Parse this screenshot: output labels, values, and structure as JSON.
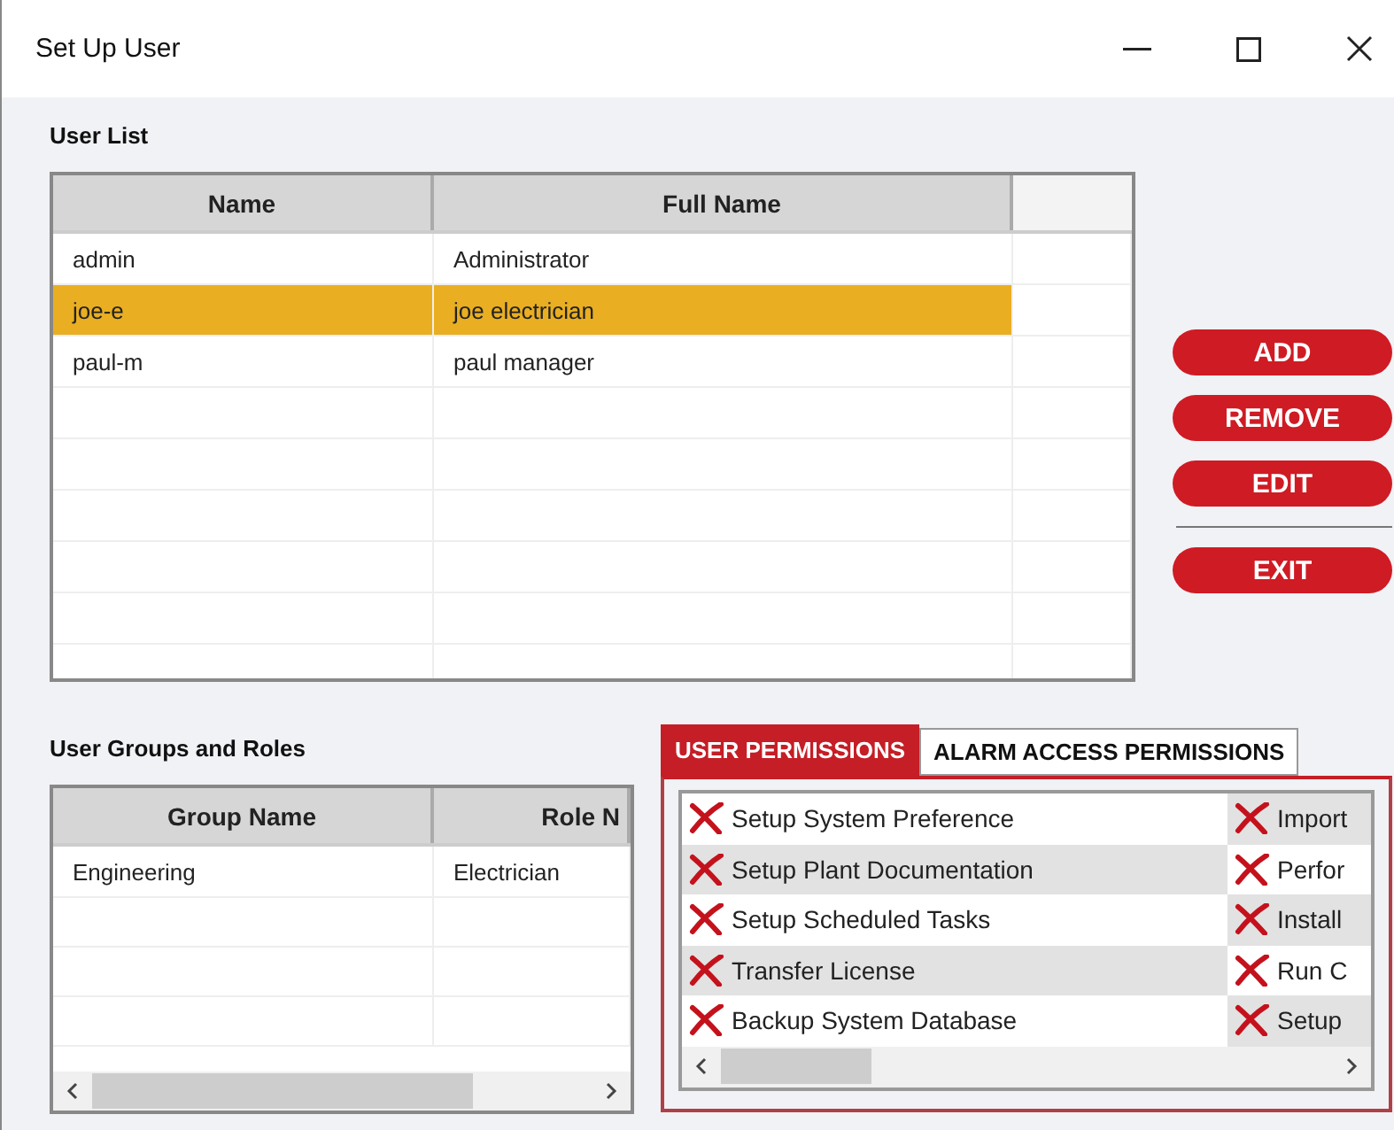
{
  "window": {
    "title": "Set Up User"
  },
  "user_list": {
    "title": "User List",
    "columns": [
      "Name",
      "Full Name"
    ],
    "rows": [
      {
        "name": "admin",
        "full_name": "Administrator",
        "selected": false
      },
      {
        "name": "joe-e",
        "full_name": "joe electrician",
        "selected": true
      },
      {
        "name": "paul-m",
        "full_name": "paul manager",
        "selected": false
      }
    ]
  },
  "buttons": [
    {
      "label": "ADD",
      "kind": "action"
    },
    {
      "label": "REMOVE",
      "kind": "action"
    },
    {
      "label": "EDIT",
      "kind": "action"
    },
    {
      "label": "EXIT",
      "kind": "exit"
    }
  ],
  "groups": {
    "title": "User Groups and Roles",
    "columns": [
      "Group Name",
      "Role N"
    ],
    "rows": [
      {
        "group": "Engineering",
        "role": "Electrician"
      }
    ]
  },
  "permission_tabs": [
    {
      "label": "USER PERMISSIONS",
      "selected": true
    },
    {
      "label": "ALARM ACCESS PERMISSIONS",
      "selected": false
    }
  ],
  "permissions": [
    [
      {
        "label": "Setup System Preference",
        "granted": false
      },
      {
        "label": "Setup Plant Documentation",
        "granted": false
      },
      {
        "label": "Setup Scheduled Tasks",
        "granted": false
      },
      {
        "label": "Transfer License",
        "granted": false
      },
      {
        "label": "Backup System Database",
        "granted": false
      }
    ],
    [
      {
        "label": "Import",
        "granted": false
      },
      {
        "label": "Perfor",
        "granted": false
      },
      {
        "label": "Install",
        "granted": false
      },
      {
        "label": "Run C",
        "granted": false
      },
      {
        "label": "Setup",
        "granted": false
      }
    ]
  ]
}
